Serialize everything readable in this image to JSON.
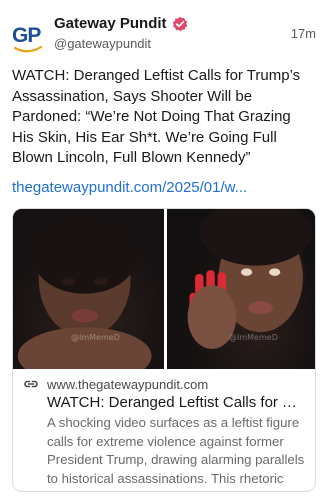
{
  "account": {
    "display_name": "Gateway Pundit",
    "handle": "@gatewaypundit",
    "avatar_letters": "GP",
    "brand_color": "#1f4f99",
    "accent_color": "#e8a317",
    "verified_color": "#e04a6a",
    "verified_icon": "verified-badge-icon"
  },
  "post": {
    "time": "17m",
    "text": "WATCH: Deranged Leftist Calls for Trump’s Assassination, Says Shooter Will be Pardoned: “We’re Not Doing That Grazing His Skin, His Ear Sh*t. We’re Going Full Blown Lincoln, Full Blown Kennedy”",
    "link_text": "thegatewaypundit.com/2025/01/w...",
    "link_color": "#1f6fd8"
  },
  "card": {
    "watermark_left": "@ImMemeD",
    "watermark_right": "@ImMemeD",
    "link_icon": "link-chain-icon",
    "domain": "www.thegatewaypundit.com",
    "title": "WATCH: Deranged Leftist Calls for Trump’s Assassination",
    "description": "A shocking video surfaces as a leftist figure calls for extreme violence against former President Trump, drawing alarming parallels to historical assassinations. This rhetoric raises serious concerns."
  }
}
